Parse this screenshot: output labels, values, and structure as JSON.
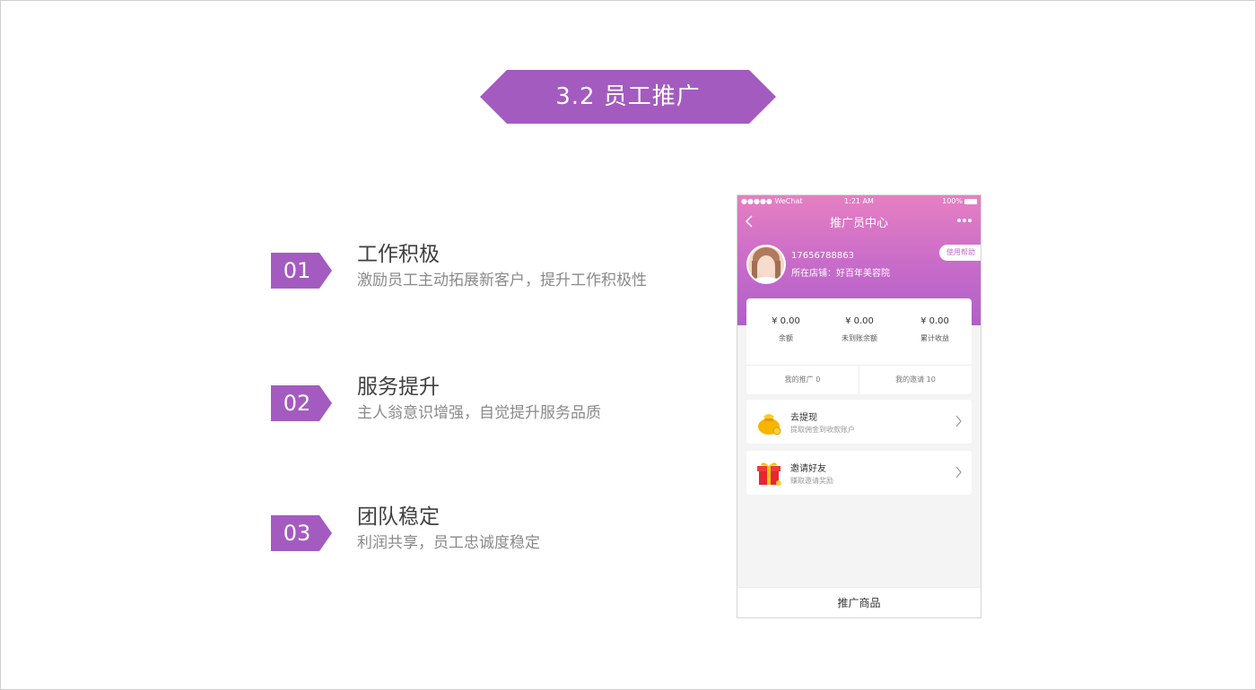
{
  "slide": {
    "title": "3.2 员工推广",
    "accent_color": "#a45bc0"
  },
  "features": [
    {
      "number": "01",
      "title": "工作积极",
      "description": "激励员工主动拓展新客户，提升工作积极性"
    },
    {
      "number": "02",
      "title": "服务提升",
      "description": "主人翁意识增强，自觉提升服务品质"
    },
    {
      "number": "03",
      "title": "团队稳定",
      "description": "利润共享，员工忠诚度稳定"
    }
  ],
  "phone": {
    "status_bar": {
      "carrier": "●●●●● WeChat",
      "time": "1:21 AM",
      "battery": "100%"
    },
    "nav_title": "推广员中心",
    "user": {
      "phone": "17656788863",
      "store": "所在店铺：好百年美容院"
    },
    "help_label": "使用帮助",
    "stats": [
      {
        "value": "¥ 0.00",
        "label": "余额"
      },
      {
        "value": "¥ 0.00",
        "label": "未到账余额"
      },
      {
        "value": "¥ 0.00",
        "label": "累计收益"
      }
    ],
    "tabs": [
      "我的推广 0",
      "我的邀请 10"
    ],
    "menu": [
      {
        "title": "去提现",
        "subtitle": "提取佣金到收款账户",
        "icon": "money-bag-icon"
      },
      {
        "title": "邀请好友",
        "subtitle": "赚取邀请奖励",
        "icon": "gift-box-icon"
      }
    ],
    "bottom_label": "推广商品"
  }
}
